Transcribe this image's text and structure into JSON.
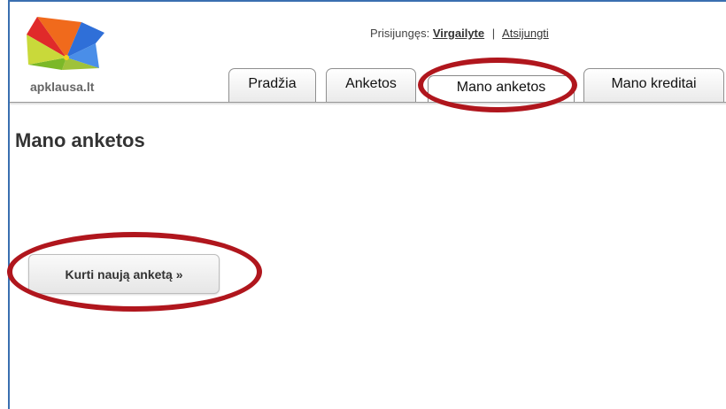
{
  "header": {
    "logo_text": "apklausa.lt",
    "login_label": "Prisijungęs:",
    "username": "Virgailyte",
    "separator": "|",
    "logout": "Atsijungti"
  },
  "tabs": [
    {
      "label": "Pradžia",
      "active": false
    },
    {
      "label": "Anketos",
      "active": false
    },
    {
      "label": "Mano anketos",
      "active": true
    },
    {
      "label": "Mano kreditai",
      "active": false
    }
  ],
  "main": {
    "title": "Mano anketos",
    "create_button": "Kurti naują anketą »"
  },
  "colors": {
    "annotation": "#b0161d",
    "frame": "#3a6fb0"
  }
}
